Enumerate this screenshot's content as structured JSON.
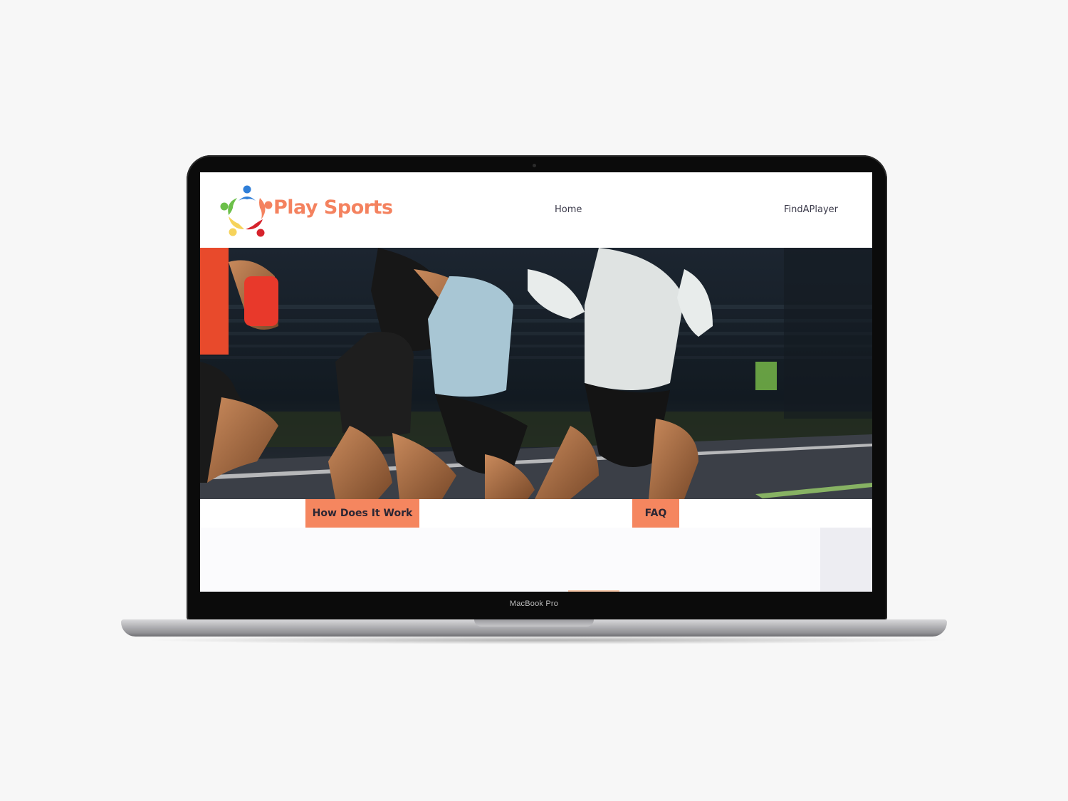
{
  "device": {
    "model_label": "MacBook Pro"
  },
  "site": {
    "brand": {
      "name": "Play Sports",
      "logo_icon": "people-circle-logo-icon",
      "brand_color": "#f4825f"
    },
    "nav": {
      "items": [
        {
          "label": "Home",
          "icon": null
        },
        {
          "label": "FindAPlayer",
          "icon": null
        }
      ]
    },
    "hero": {
      "image_subject": "sprinters-running-photo"
    },
    "actions": {
      "how_label": "How Does It Work",
      "faq_label": "FAQ",
      "button_color": "#f5865f"
    }
  }
}
